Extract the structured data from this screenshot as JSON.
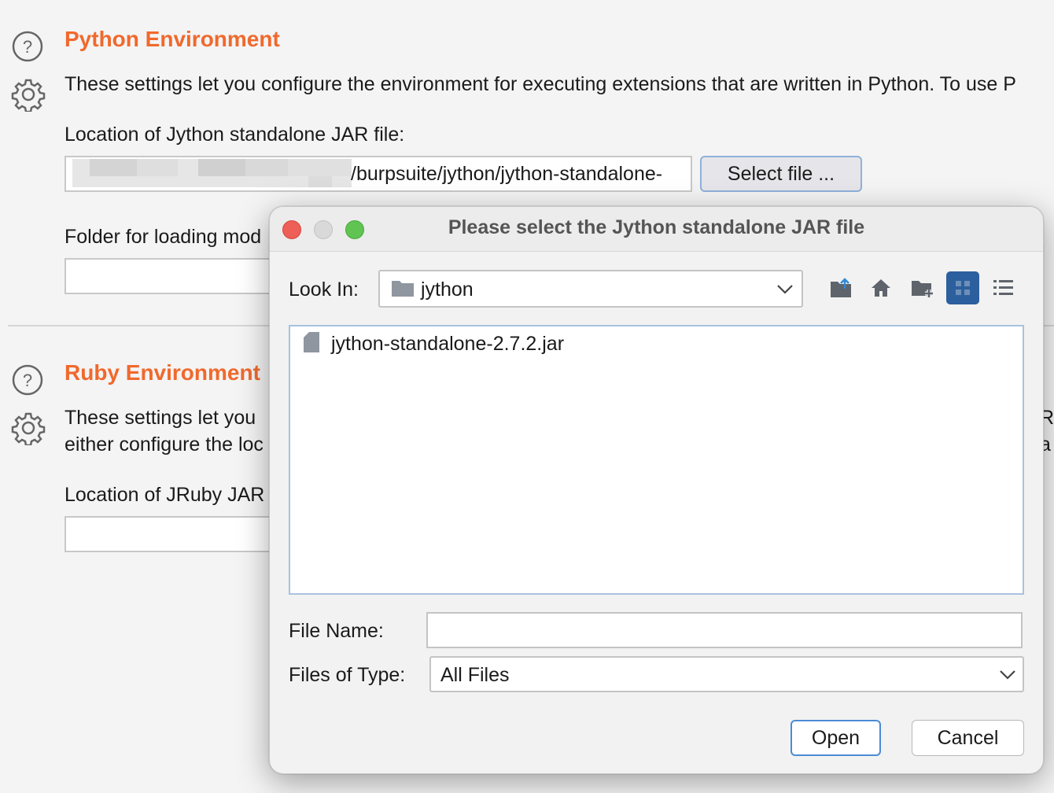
{
  "python": {
    "title": "Python Environment",
    "description": "These settings let you configure the environment for executing extensions that are written in Python. To use P",
    "jar_label": "Location of Jython standalone JAR file:",
    "jar_value": "/burpsuite/jython/jython-standalone-",
    "select_button": "Select file ...",
    "folder_label": "Folder for loading mod"
  },
  "ruby": {
    "title": "Ruby Environment",
    "description_line1": "These settings let you",
    "description_line2": "either configure the loc",
    "right_fragment_1": "Ru",
    "right_fragment_2": "a c",
    "jar_label": "Location of JRuby JAR"
  },
  "dialog": {
    "title": "Please select the Jython standalone JAR file",
    "look_in_label": "Look In:",
    "look_in_value": "jython",
    "files": [
      {
        "name": "jython-standalone-2.7.2.jar"
      }
    ],
    "file_name_label": "File Name:",
    "file_name_value": "",
    "files_of_type_label": "Files of Type:",
    "files_of_type_value": "All Files",
    "open_button": "Open",
    "cancel_button": "Cancel"
  },
  "icons": {
    "help": "help-icon",
    "settings": "gear-icon",
    "folder": "folder-icon",
    "up_folder": "up-folder-icon",
    "home": "home-icon",
    "new_folder": "new-folder-icon",
    "grid_view": "grid-view-icon",
    "list_view": "list-view-icon",
    "file": "file-icon",
    "chevron": "chevron-down-icon"
  },
  "colors": {
    "accent": "#f0692d",
    "selected_view": "#2c5f9e",
    "close": "#ed5f57",
    "zoom": "#5fc452"
  }
}
